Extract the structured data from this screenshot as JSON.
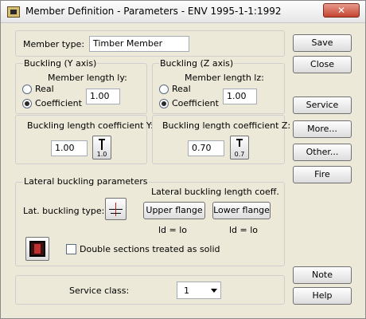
{
  "window": {
    "title": "Member Definition - Parameters - ENV 1995-1-1:1992",
    "close_glyph": "✕"
  },
  "member": {
    "type_label": "Member type:",
    "type_value": "Timber Member"
  },
  "buckling_y": {
    "header": "Buckling (Y axis)",
    "length_label": "Member length ly:",
    "real_label": "Real",
    "coef_label": "Coefficient",
    "length_value": "1.00",
    "selected": "Coefficient",
    "coeff_label": "Buckling length coefficient Y:",
    "coeff_value": "1.00",
    "icon_value": "1.0"
  },
  "buckling_z": {
    "header": "Buckling (Z axis)",
    "length_label": "Member length lz:",
    "real_label": "Real",
    "coef_label": "Coefficient",
    "length_value": "1.00",
    "selected": "Coefficient",
    "coeff_label": "Buckling length coefficient Z:",
    "coeff_value": "0.70",
    "icon_value": "0.7"
  },
  "lateral": {
    "header": "Lateral buckling parameters",
    "coeff_label": "Lateral buckling length coeff.",
    "type_label": "Lat. buckling type:",
    "upper_label": "Upper flange",
    "lower_label": "Lower flange",
    "ld_upper": "ld  =  lo",
    "ld_lower": "ld  =  lo",
    "double_label": "Double sections treated as solid",
    "double_checked": false
  },
  "service": {
    "label": "Service class:",
    "value": "1"
  },
  "buttons": {
    "save": "Save",
    "close": "Close",
    "service": "Service",
    "more": "More...",
    "other": "Other...",
    "fire": "Fire",
    "note": "Note",
    "help": "Help"
  },
  "icons": {
    "app": "timber-member-icon",
    "lat_type": "lateral-buckling-type-icon",
    "section": "section-icon"
  }
}
